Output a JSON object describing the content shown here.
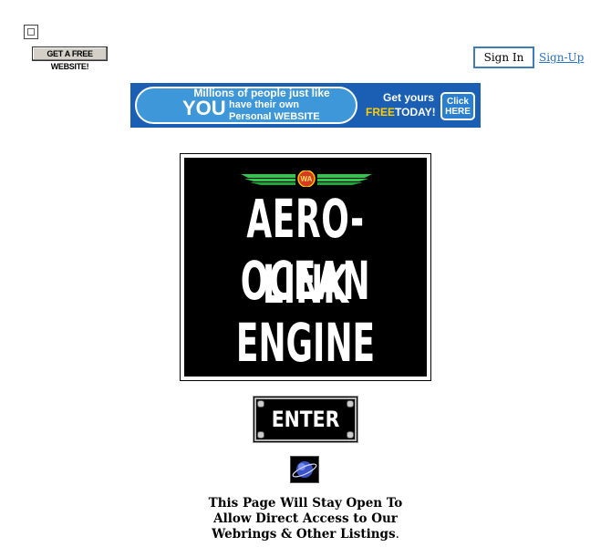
{
  "top_bar": {
    "free_website_label": "GET A FREE WEBSITE!",
    "sign_in_label": "Sign In",
    "sign_up_label": "Sign-Up"
  },
  "banner": {
    "line1": "Millions of people just like",
    "you": "YOU",
    "line2": "have their own",
    "line3": "Personal WEBSITE",
    "get_yours": "Get yours",
    "free": "FREE",
    "today": "TODAY!",
    "click_here": "Click HERE"
  },
  "logo": {
    "badge": "WA",
    "line1": "AERO-OCEAN",
    "line2": "LINK",
    "line3": "ENGINE"
  },
  "enter_button": {
    "label": "ENTER"
  },
  "notice": {
    "line1": "This Page Will Stay Open To",
    "line2": "Allow Direct Access to Our",
    "line3": "Webrings & Other Listings",
    "line3_end": "."
  },
  "colors": {
    "link": "#2a74c4",
    "signin_border": "#3e7dbb",
    "banner_bg": "#1a5fb4",
    "banner_accent": "#ffcc00",
    "wing_green": "#2ec84a",
    "badge_red": "#d93a1e"
  },
  "icons": [
    "broken-image-icon",
    "winged-badge-icon",
    "planet-icon"
  ]
}
